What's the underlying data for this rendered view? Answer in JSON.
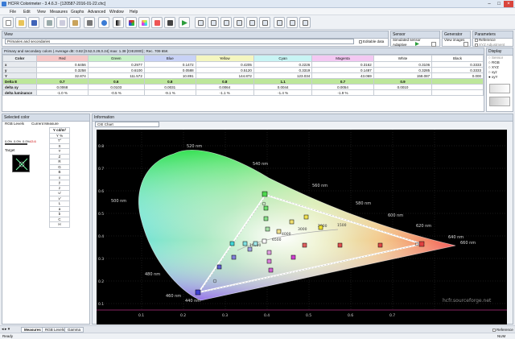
{
  "app": {
    "title": "HCFR Colorimeter - 3.4.6.3 - [120587-2016-01-22.chc]"
  },
  "menu": [
    "File",
    "Edit",
    "View",
    "Measures",
    "Graphs",
    "Advanced",
    "Window",
    "Help"
  ],
  "view_panel": {
    "title": "View",
    "selected": "Primaries and secondaries",
    "editable_label": "Editable data"
  },
  "sensor_panel": {
    "title": "Sensor",
    "sensor": "Simulated sensor",
    "mode": "Adaptive"
  },
  "generator_panel": {
    "title": "Generator",
    "generator": "View images"
  },
  "parameters_panel": {
    "title": "Parameters",
    "reference": "Reference",
    "xyz_adjust": "XYZ Adjustment"
  },
  "table": {
    "caption": "Primary and secondary colors ( Average dE: 0.82 [0.52,0.29,0.24] max: 1.38 [CIE2000] ; Rec. 709 65K ",
    "columns": [
      "Color",
      "Red",
      "Green",
      "Blue",
      "Yellow",
      "Cyan",
      "Magenta",
      "White",
      "Black"
    ],
    "column_colors": [
      "#e8ebef",
      "#f6c8c8",
      "#c8f1c8",
      "#c8d2f6",
      "#f4f6c0",
      "#c8f4f4",
      "#f3c8f2",
      "#ffffff",
      "#ffffff"
    ],
    "rows": [
      {
        "label": "x",
        "values": [
          "0.6456",
          "0.2977",
          "0.1472",
          "0.4205",
          "0.2226",
          "0.3162",
          "0.3106",
          "0.3333"
        ]
      },
      {
        "label": "y",
        "values": [
          "0.3258",
          "0.6100",
          "0.0588",
          "0.5120",
          "0.3319",
          "0.1487",
          "0.3285",
          "0.3333"
        ]
      },
      {
        "label": "Y",
        "values": [
          "32.874",
          "111.572",
          "10.891",
          "144.872",
          "123.034",
          "43.069",
          "158.087",
          "0.000"
        ]
      },
      {
        "label": "Delta E",
        "values": [
          "0.7",
          "0.6",
          "0.8",
          "0.8",
          "1.1",
          "0.7",
          "0.9",
          ""
        ]
      },
      {
        "label": "delta xy",
        "values": [
          "0.0068",
          "0.0103",
          "0.0031",
          "0.0064",
          "0.0044",
          "0.0054",
          "0.0010",
          ""
        ]
      },
      {
        "label": "delta luminance",
        "values": [
          "-1.0 %",
          "-0.5 %",
          "-9.1 %",
          "-1.1 %",
          "-1.4 %",
          "-1.9 %",
          "",
          ""
        ]
      }
    ]
  },
  "display_panel": {
    "title": "Display",
    "options": [
      "Sensor",
      "RGB",
      "XYZ",
      "xyz",
      "xyY"
    ]
  },
  "selected_color": {
    "title": "Selected color",
    "rgb_levels": "RGB Levels",
    "current_measure": "Current Measure",
    "levels": [
      "0.0%",
      "0.0%",
      "0.0%",
      "43.6"
    ],
    "target": "Target",
    "measure_rows": [
      "Y cd/m²",
      "Y %",
      "T°",
      "X",
      "Y",
      "Z",
      "R",
      "G",
      "B",
      "x",
      "y",
      "z",
      "u'",
      "v'",
      "L",
      "a",
      "b",
      "C",
      "H"
    ]
  },
  "information": {
    "title": "Information",
    "chart_select": "CIE Chart",
    "watermark": "hcfr.sourceforge.net",
    "wavelengths": [
      "520 nm",
      "540 nm",
      "560 nm",
      "580 nm",
      "600 nm",
      "620 nm",
      "640 nm",
      "660 nm",
      "500 nm",
      "480 nm",
      "460 nm",
      "440 nm"
    ],
    "temperatures": [
      "1500",
      "2000",
      "3000",
      "4000",
      "6500",
      "10000"
    ],
    "x_ticks": [
      "0.1",
      "0.2",
      "0.3",
      "0.4",
      "0.5",
      "0.6",
      "0.7"
    ],
    "y_ticks": [
      "0.8",
      "0.7",
      "0.6",
      "0.5",
      "0.4",
      "0.3",
      "0.2",
      "0.1"
    ]
  },
  "tabs": [
    "Measures",
    "RGB Levels",
    "Gamma"
  ],
  "status": {
    "text": "Ready",
    "num": "NUM"
  }
}
